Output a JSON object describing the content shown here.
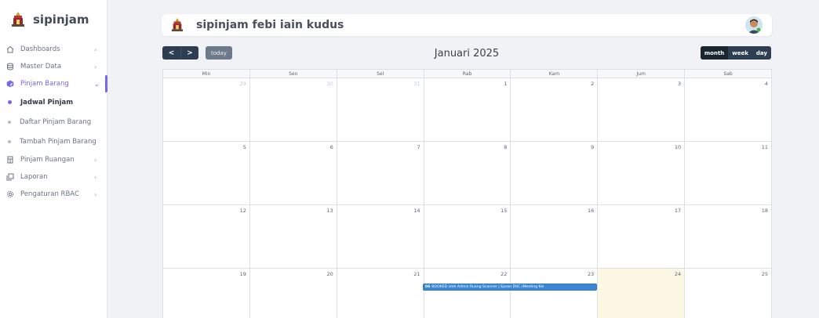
{
  "brand": {
    "name": "sipinjam"
  },
  "sidebar": {
    "items": [
      {
        "label": "Dashboards",
        "icon": "home-icon"
      },
      {
        "label": "Master Data",
        "icon": "database-icon"
      },
      {
        "label": "Pinjam Barang",
        "icon": "box-icon"
      },
      {
        "label": "Pinjam Ruangan",
        "icon": "door-icon"
      },
      {
        "label": "Laporan",
        "icon": "files-icon"
      },
      {
        "label": "Pengaturan RBAC",
        "icon": "settings-icon"
      }
    ],
    "subitems": [
      {
        "label": "Jadwal Pinjam"
      },
      {
        "label": "Daftar Pinjam Barang"
      },
      {
        "label": "Tambah Pinjam Barang"
      }
    ]
  },
  "header": {
    "title": "sipinjam febi iain kudus"
  },
  "calendar": {
    "title": "Januari 2025",
    "today_label": "today",
    "prev_label": "<",
    "next_label": ">",
    "views": [
      "month",
      "week",
      "day"
    ],
    "weekdays": [
      "Min",
      "Sen",
      "Sel",
      "Rab",
      "Kam",
      "Jum",
      "Sab"
    ],
    "weeks": [
      [
        "29",
        "30",
        "31",
        "1",
        "2",
        "3",
        "4"
      ],
      [
        "5",
        "6",
        "7",
        "8",
        "9",
        "10",
        "11"
      ],
      [
        "12",
        "13",
        "14",
        "15",
        "16",
        "17",
        "18"
      ],
      [
        "19",
        "20",
        "21",
        "22",
        "23",
        "24",
        "25"
      ]
    ],
    "event": {
      "time": "06",
      "text": "BOOKED oleh Admin Ruang Scanner | Epson DSC (Meeting Kel"
    }
  },
  "colors": {
    "accent": "#7367f0",
    "nav_dark": "#2c3e50",
    "event_blue": "#3a87d6",
    "today_bg": "#fcf8e3"
  }
}
